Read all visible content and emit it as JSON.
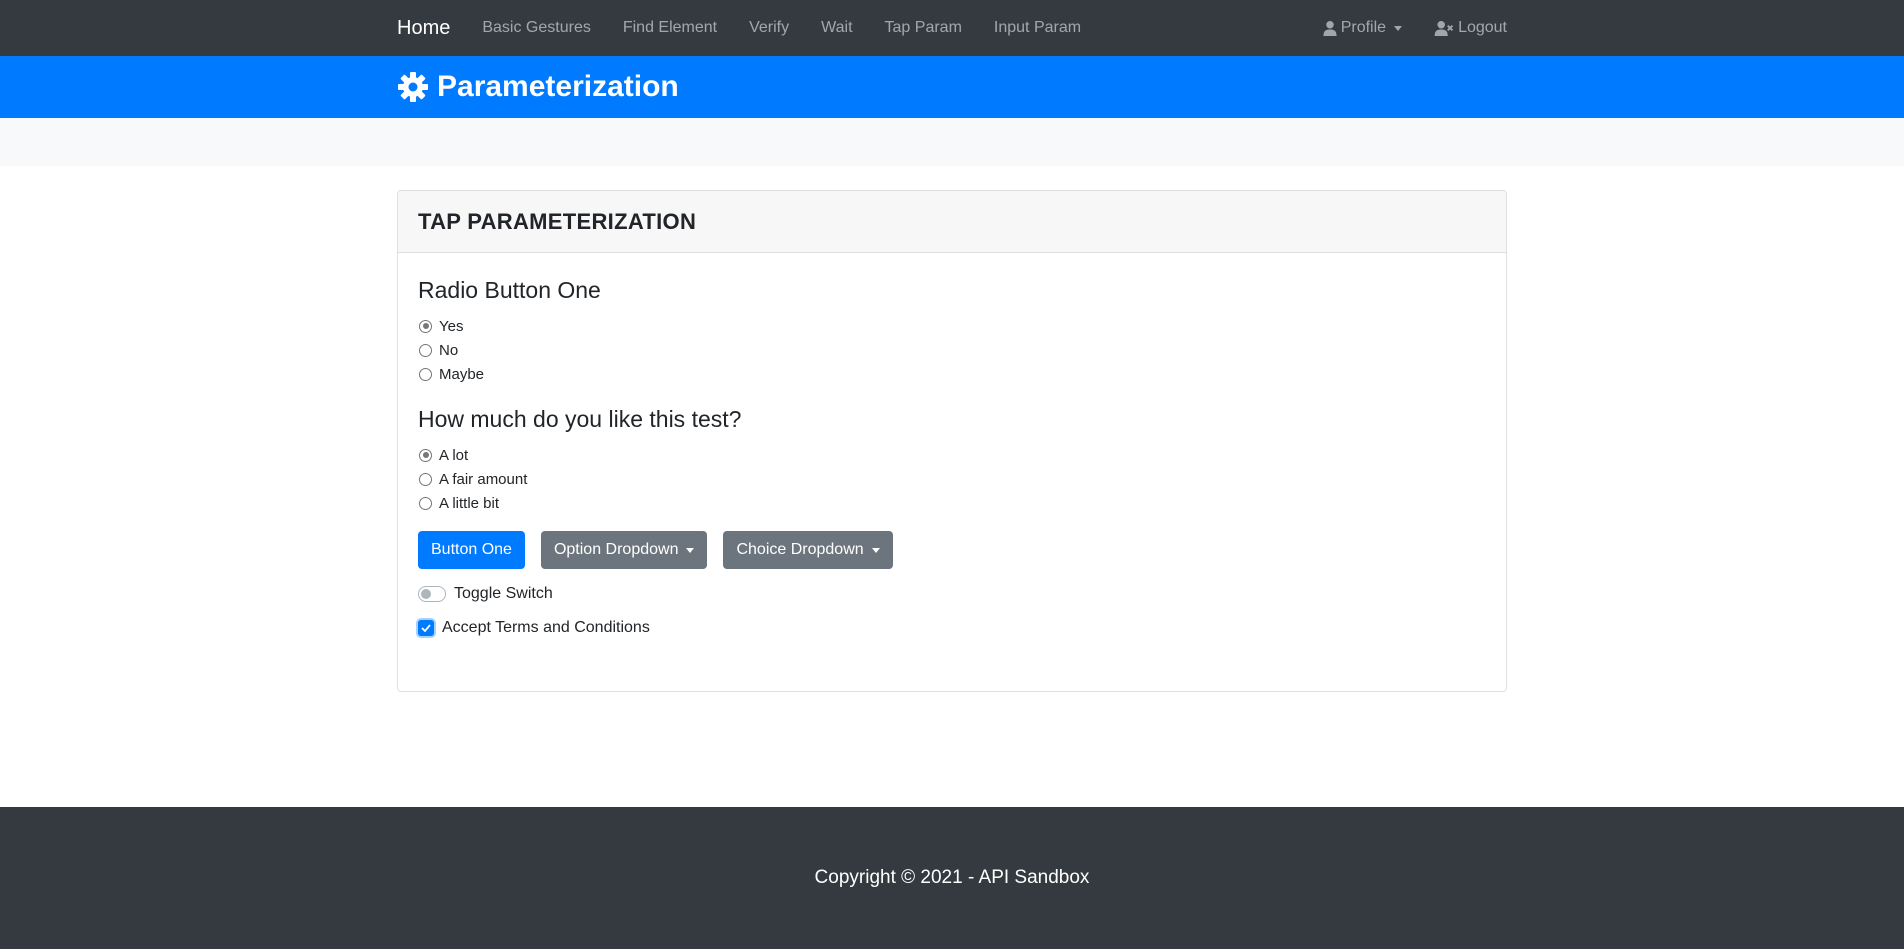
{
  "navbar": {
    "brand": "Home",
    "links": [
      "Basic Gestures",
      "Find Element",
      "Verify",
      "Wait",
      "Tap Param",
      "Input Param"
    ],
    "profile_label": "Profile",
    "logout_label": "Logout"
  },
  "header": {
    "title": "Parameterization"
  },
  "card": {
    "title": "TAP PARAMETERIZATION",
    "group1": {
      "heading": "Radio Button One",
      "options": [
        "Yes",
        "No",
        "Maybe"
      ],
      "selected": "Yes"
    },
    "group2": {
      "heading": "How much do you like this test?",
      "options": [
        "A lot",
        "A fair amount",
        "A little bit"
      ],
      "selected": "A lot"
    },
    "button_one": "Button One",
    "option_dropdown": "Option Dropdown",
    "choice_dropdown": "Choice Dropdown",
    "toggle_label": "Toggle Switch",
    "toggle_on": false,
    "terms_label": "Accept Terms and Conditions",
    "terms_checked": true
  },
  "footer": {
    "copyright": "Copyright © 2021 - API Sandbox"
  },
  "colors": {
    "navbar": "#343a40",
    "primary": "#007bff",
    "secondary": "#6c757d"
  }
}
